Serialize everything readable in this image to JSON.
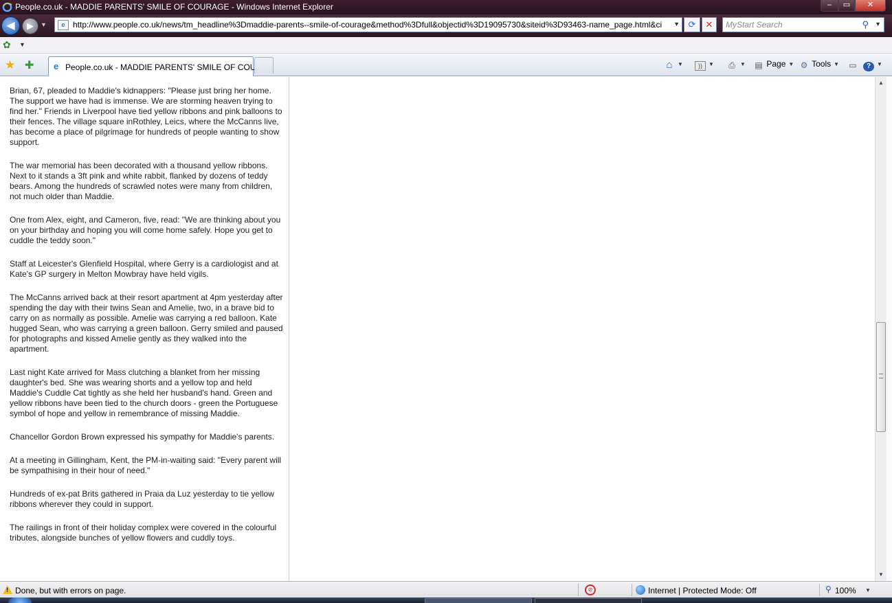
{
  "window": {
    "title": "People.co.uk - MADDIE PARENTS' SMILE OF COURAGE - Windows Internet Explorer",
    "minimize": "–",
    "maximize": "▭",
    "close": "✕"
  },
  "address_bar": {
    "url": "http://www.people.co.uk/news/tm_headline%3Dmaddie-parents--smile-of-courage&method%3Dfull&objectid%3D19095730&siteid%3D93463-name_page.html&ci",
    "search_placeholder": "MyStart Search"
  },
  "tab": {
    "label": "People.co.uk - MADDIE PARENTS' SMILE OF COU..."
  },
  "command_bar": {
    "page_label": "Page",
    "tools_label": "Tools"
  },
  "article": {
    "paragraphs": [
      "Brian, 67, pleaded to Maddie's kidnappers: \"Please just bring her home. The support we have had is immense. We are storming heaven trying to find her.\" Friends in Liverpool have tied yellow ribbons and pink balloons to their fences. The village square inRothley, Leics, where the McCanns live, has become a place of pilgrimage for hundreds of people wanting to show support.",
      "The war memorial has been decorated with a thousand yellow ribbons. Next to it stands a 3ft pink and white rabbit, flanked by dozens of teddy bears. Among the hundreds of scrawled notes were many from children, not much older than Maddie.",
      "One from Alex, eight, and Cameron, five, read: \"We are thinking about you on your birthday and hoping you will come home safely. Hope you get to cuddle the teddy soon.\"",
      "Staff at Leicester's Glenfield Hospital, where Gerry is a cardiologist and at Kate's GP surgery in Melton Mowbray have held vigils.",
      "The McCanns arrived back at their resort apartment at 4pm yesterday after spending the day with their twins Sean and Amelie, two, in a brave bid to carry on as normally as possible. Amelie was carrying a red balloon. Kate hugged Sean, who was carrying a green balloon. Gerry smiled and paused for photographs and kissed Amelie gently as they walked into the apartment.",
      "Last night Kate arrived for Mass clutching a blanket from her missing daughter's bed. She was wearing shorts and a yellow top and held Maddie's Cuddle Cat tightly as she held her husband's hand. Green and yellow ribbons have been tied to the church doors - green the Portuguese symbol of hope and yellow in remembrance of missing Maddie.",
      "Chancellor Gordon Brown expressed his sympathy for Maddie's parents.",
      "At a meeting in Gillingham, Kent, the PM-in-waiting said: \"Every parent will be sympathising in their hour of need.\"",
      "Hundreds of ex-pat Brits gathered in Praia da Luz yesterday to tie yellow ribbons wherever they could in support.",
      "The railings in front of their holiday complex were covered in the colourful tributes, alongside bunches of yellow flowers and cuddly toys."
    ]
  },
  "status_bar": {
    "status_text": "Done, but with errors on page.",
    "zone_text": "Internet | Protected Mode: Off",
    "zoom": "100%"
  },
  "scroll": {
    "position_fraction": 0.63
  },
  "colors": {
    "title_bar": "#2a1220",
    "accent": "#1d5ab5",
    "warning": "#f0c020"
  },
  "icons": [
    "ie-logo-icon",
    "back-arrow-icon",
    "forward-arrow-icon",
    "page-icon",
    "refresh-icon",
    "stop-icon",
    "search-icon",
    "favorites-star-icon",
    "add-favorites-icon",
    "home-icon",
    "feeds-icon",
    "print-icon",
    "page-menu-icon",
    "tools-gear-icon",
    "research-icon",
    "help-icon",
    "warning-icon",
    "popup-blocker-icon",
    "internet-zone-icon",
    "zoom-icon"
  ]
}
